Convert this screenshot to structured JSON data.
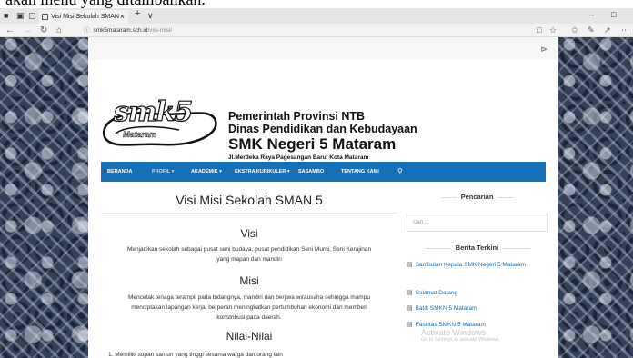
{
  "top_caption": "akan menu yang ditambahkan.",
  "browser": {
    "tab_title": "Visi Misi Sekolah SMAN",
    "tab_close": "×",
    "new_tab": "+",
    "tab_dropdown": "∨",
    "url_domain": "smk5mataram.sch.id",
    "url_path": "/visi-misi/",
    "win_minimize": "–",
    "win_maximize": "□"
  },
  "site": {
    "logo_text": "smk5",
    "logo_subtext": "Mataram",
    "org_line1": "Pemerintah Provinsi NTB",
    "org_line2": "Dinas Pendidikan dan Kebudayaan",
    "org_line3": "SMK Negeri 5 Mataram",
    "org_line4": "Jl.Merdeka Raya Pagesangan Baru, Kota Mataram"
  },
  "menu": [
    {
      "label": "BERANDA"
    },
    {
      "label": "PROFIL ▾"
    },
    {
      "label": "AKADEMIK ▾"
    },
    {
      "label": "EKSTRA KURIKULER ▾"
    },
    {
      "label": "SASAMBO"
    },
    {
      "label": "TENTANG KAMI"
    }
  ],
  "content": {
    "title": "Visi Misi Sekolah SMAN 5",
    "visi_heading": "Visi",
    "visi_line1": "Menjadikan sekolah sebagai pusat seni budaya, pusat pendidikan Seni Murni, Seni Kerajinan",
    "visi_line2": "yang mapan dan mandiri",
    "misi_heading": "Misi",
    "misi_line1": "Mencetak tenaga terampil pada bidangnya, mandiri dan berjiwa wirausaha sehingga mampu",
    "misi_line2": "menciptakan lapangan kerja, berperan meningkatkan pertumbuhan ekonomi dan memberi",
    "misi_line3": "konstribusi pada daerah.",
    "nilai_heading": "Nilai-Nilai",
    "nilai_item1": "1.  Memiliki sopan santun yang tinggi sesama warga dan orang lain"
  },
  "sidebar": {
    "search_heading": "Pencarian",
    "search_placeholder": "Cari ...",
    "news_heading": "Berita Terkini",
    "news": [
      {
        "title": "Sambutan Kepala SMK Negeri 5 Mataram"
      },
      {
        "title": "Selamat Datang"
      },
      {
        "title": "Batik SMKN 5 Mataram"
      },
      {
        "title": "Fasilitas SMKN 5 Mataram"
      }
    ]
  },
  "watermark": {
    "line1": "Activate Windows",
    "line2": "Go to Settings to activate Windows."
  }
}
